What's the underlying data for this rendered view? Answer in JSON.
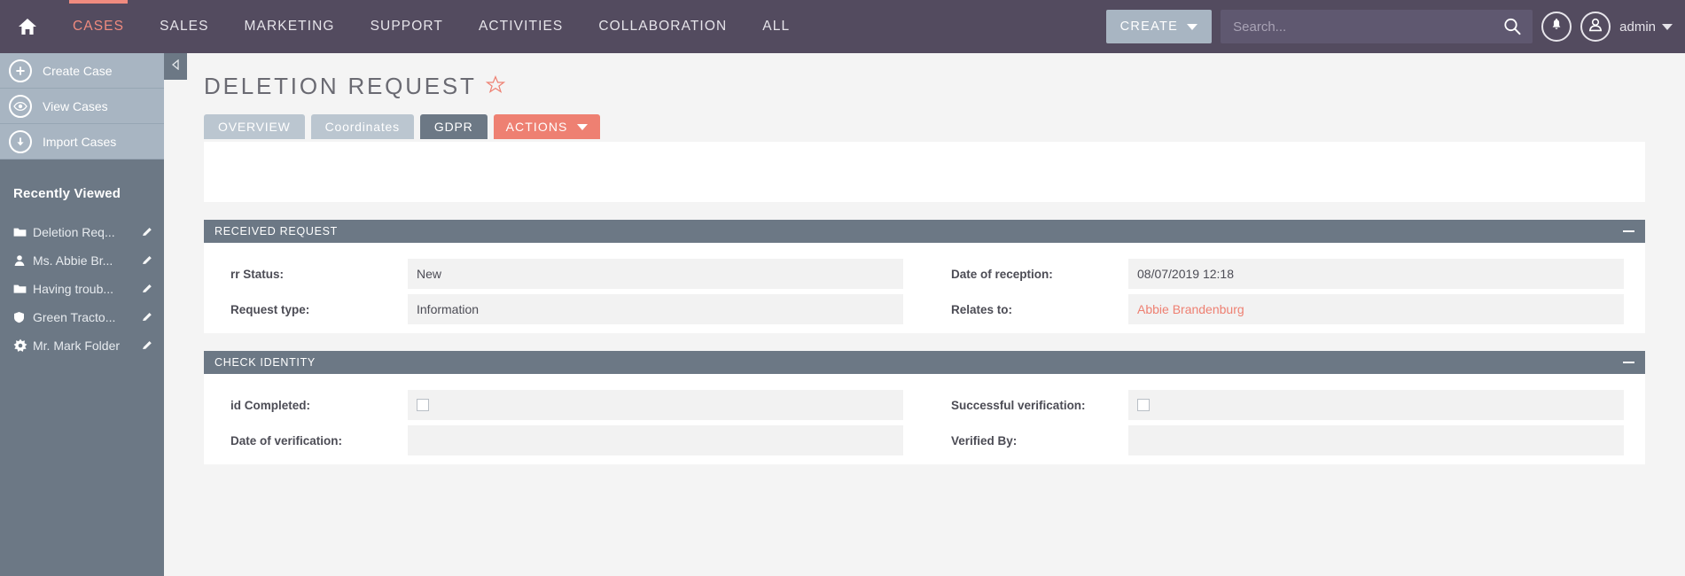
{
  "topnav": {
    "home_icon": "home-icon",
    "items": [
      {
        "label": "CASES",
        "active": true
      },
      {
        "label": "SALES",
        "active": false
      },
      {
        "label": "MARKETING",
        "active": false
      },
      {
        "label": "SUPPORT",
        "active": false
      },
      {
        "label": "ACTIVITIES",
        "active": false
      },
      {
        "label": "COLLABORATION",
        "active": false
      },
      {
        "label": "ALL",
        "active": false
      }
    ],
    "create_label": "CREATE",
    "search_placeholder": "Search...",
    "search_value": "",
    "admin_label": "admin",
    "accent_color": "#f08b7f",
    "bar_color": "#534b5f"
  },
  "sidebar": {
    "actions": [
      {
        "label": "Create Case",
        "icon": "plus-circle-icon"
      },
      {
        "label": "View Cases",
        "icon": "eye-circle-icon"
      },
      {
        "label": "Import Cases",
        "icon": "download-circle-icon"
      }
    ],
    "recent_title": "Recently Viewed",
    "recent_items": [
      {
        "label": "Deletion Req...",
        "icon": "folder-icon"
      },
      {
        "label": "Ms. Abbie Br...",
        "icon": "person-icon"
      },
      {
        "label": "Having troub...",
        "icon": "folder-icon"
      },
      {
        "label": "Green Tracto...",
        "icon": "shield-icon"
      },
      {
        "label": "Mr. Mark Folder",
        "icon": "star-burst-icon"
      }
    ],
    "edit_icon": "pencil-icon"
  },
  "main": {
    "collapse_icon": "collapse-left-icon",
    "page_title": "DELETION REQUEST",
    "favorite_icon": "star-outline-icon",
    "tabs": [
      {
        "label": "OVERVIEW",
        "active": false,
        "uppercase": true
      },
      {
        "label": "Coordinates",
        "active": false,
        "uppercase": false
      },
      {
        "label": "GDPR",
        "active": true,
        "uppercase": false
      }
    ],
    "actions_label": "ACTIONS",
    "panels": [
      {
        "title": "RECEIVED REQUEST",
        "collapse_icon": "minus-icon",
        "rows": [
          {
            "left": {
              "label": "rr Status:",
              "value": "New",
              "type": "text"
            },
            "right": {
              "label": "Date of reception:",
              "value": "08/07/2019 12:18",
              "type": "text"
            }
          },
          {
            "left": {
              "label": "Request type:",
              "value": "Information",
              "type": "text"
            },
            "right": {
              "label": "Relates to:",
              "value": "Abbie Brandenburg",
              "type": "link"
            }
          }
        ]
      },
      {
        "title": "CHECK IDENTITY",
        "collapse_icon": "minus-icon",
        "rows": [
          {
            "left": {
              "label": "id Completed:",
              "value": "",
              "type": "checkbox",
              "checked": false
            },
            "right": {
              "label": "Successful verification:",
              "value": "",
              "type": "checkbox",
              "checked": false
            }
          },
          {
            "left": {
              "label": "Date of verification:",
              "value": "",
              "type": "blank"
            },
            "right": {
              "label": "Verified By:",
              "value": "",
              "type": "blank"
            }
          }
        ]
      }
    ]
  }
}
